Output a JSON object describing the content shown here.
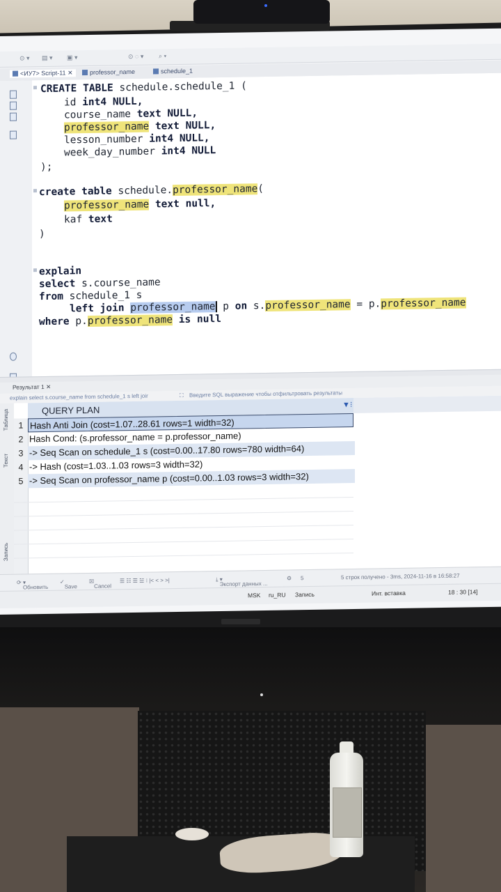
{
  "editor": {
    "tabs": [
      "<ИУ7> Script-11",
      "professor_name",
      "schedule_1"
    ],
    "lines": {
      "l1": [
        "CREATE TABLE",
        " schedule.schedule_1 ("
      ],
      "l2": [
        "id ",
        "int4 NULL,"
      ],
      "l3": [
        "course_name ",
        "text NULL,"
      ],
      "l4": [
        "professor_name",
        " ",
        "text NULL,"
      ],
      "l5": [
        "lesson_number ",
        "int4 NULL,"
      ],
      "l6": [
        "week_day_number ",
        "int4 NULL"
      ],
      "l7": ");",
      "l8": [
        "create table",
        " schedule.",
        "professor_name",
        "("
      ],
      "l9": [
        "professor_name",
        " ",
        "text null,"
      ],
      "l10": [
        "kaf ",
        "text"
      ],
      "l11": ")",
      "l12": "explain",
      "l13": [
        "select",
        " s.course_name"
      ],
      "l14": [
        "from",
        " schedule_1 s"
      ],
      "l15": [
        "left join",
        " ",
        "professor_name",
        " p ",
        "on",
        " s.",
        "professor_name",
        " = p.",
        "professor_name"
      ],
      "l16": [
        "where",
        " p.",
        "professor_name",
        " ",
        "is null"
      ]
    }
  },
  "results": {
    "tab_label": "Результат 1",
    "filter_query": "explain select s.course_name from schedule_1 s left joir",
    "filter_placeholder": "Введите SQL выражение чтобы отфильтровать результаты",
    "side_labels": [
      "Таблица",
      "Текст",
      "Запись"
    ],
    "column_header": "QUERY PLAN",
    "rows": [
      {
        "num": "1",
        "text": "Hash Anti Join  (cost=1.07..28.61 rows=1 width=32)"
      },
      {
        "num": "2",
        "text": "  Hash Cond: (s.professor_name = p.professor_name)"
      },
      {
        "num": "3",
        "text": "  ->  Seq Scan on schedule_1 s  (cost=0.00..17.80 rows=780 width=64)"
      },
      {
        "num": "4",
        "text": "  ->  Hash  (cost=1.03..1.03 rows=3 width=32)"
      },
      {
        "num": "5",
        "text": "        ->  Seq Scan on professor_name p  (cost=0.00..1.03 rows=3 width=32)"
      }
    ]
  },
  "status": {
    "refresh": "Обновить",
    "save": "Save",
    "cancel": "Cancel",
    "export": "Экспорт данных ...",
    "count_value": "5",
    "fetched": "5 строк получено - 3ms, 2024-11-16 в 16:58:27"
  },
  "bottom": {
    "timezone": "MSK",
    "locale": "ru_RU",
    "mode": "Запись",
    "insert_mode": "Инт. вставка",
    "position": "18 : 30 [14]"
  },
  "colors": {
    "highlight": "#efe47a",
    "selection": "#b7ccef",
    "grid_header": "#d8e2f0"
  }
}
